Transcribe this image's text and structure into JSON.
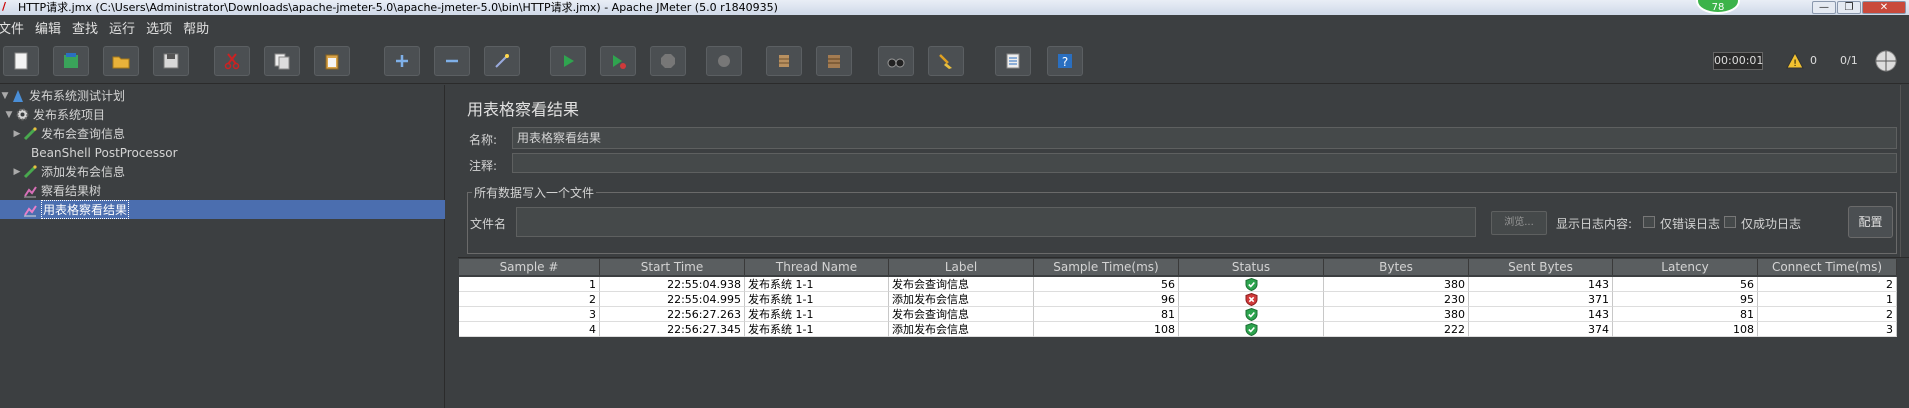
{
  "window": {
    "title": "HTTP请求.jmx (C:\\Users\\Administrator\\Downloads\\apache-jmeter-5.0\\apache-jmeter-5.0\\bin\\HTTP请求.jmx) - Apache JMeter (5.0 r1840935)",
    "badge": "78",
    "min": "—",
    "max": "❐",
    "close": "✕"
  },
  "menu": [
    "文件",
    "编辑",
    "查找",
    "运行",
    "选项",
    "帮助"
  ],
  "toolbar": {
    "timer": "00:00:01",
    "warnings": "0",
    "threads": "0/1"
  },
  "tree": {
    "items": [
      {
        "label": "发布系统测试计划"
      },
      {
        "label": "发布系统项目"
      },
      {
        "label": "发布会查询信息"
      },
      {
        "label": "BeanShell PostProcessor"
      },
      {
        "label": "添加发布会信息"
      },
      {
        "label": "察看结果树"
      },
      {
        "label": "用表格察看结果"
      }
    ]
  },
  "panel": {
    "title": "用表格察看结果",
    "name_label": "名称:",
    "name_value": "用表格察看结果",
    "comment_label": "注释:",
    "comment_value": "",
    "fieldset_legend": "所有数据写入一个文件",
    "file_label": "文件名",
    "file_value": "",
    "browse_label": "浏览...",
    "log_label": "显示日志内容:",
    "errors_only_label": "仅错误日志",
    "success_only_label": "仅成功日志",
    "config_label": "配置"
  },
  "table": {
    "headers": [
      "Sample #",
      "Start Time",
      "Thread Name",
      "Label",
      "Sample Time(ms)",
      "Status",
      "Bytes",
      "Sent Bytes",
      "Latency",
      "Connect Time(ms)"
    ],
    "rows": [
      {
        "sample": "1",
        "start": "22:55:04.938",
        "thread": "发布系统 1-1",
        "label": "发布会查询信息",
        "time": "56",
        "status": "success",
        "bytes": "380",
        "sent": "143",
        "latency": "56",
        "connect": "2"
      },
      {
        "sample": "2",
        "start": "22:55:04.995",
        "thread": "发布系统 1-1",
        "label": "添加发布会信息",
        "time": "96",
        "status": "error",
        "bytes": "230",
        "sent": "371",
        "latency": "95",
        "connect": "1"
      },
      {
        "sample": "3",
        "start": "22:56:27.263",
        "thread": "发布系统 1-1",
        "label": "发布会查询信息",
        "time": "81",
        "status": "success",
        "bytes": "380",
        "sent": "143",
        "latency": "81",
        "connect": "2"
      },
      {
        "sample": "4",
        "start": "22:56:27.345",
        "thread": "发布系统 1-1",
        "label": "添加发布会信息",
        "time": "108",
        "status": "success",
        "bytes": "222",
        "sent": "374",
        "latency": "108",
        "connect": "3"
      }
    ]
  },
  "colors": {
    "background": "#3c3f41",
    "selection": "#4b6eaf",
    "success": "#2da44e",
    "error": "#d03a3a"
  }
}
